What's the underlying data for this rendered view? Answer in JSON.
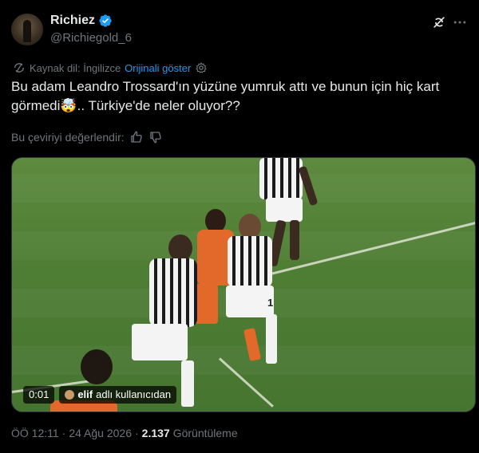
{
  "author": {
    "display_name": "Richiez",
    "handle": "@Richiegold_6"
  },
  "translation": {
    "source_label": "Kaynak dil: İngilizce",
    "show_original": "Orijinali göster"
  },
  "tweet": {
    "text_line1": "Bu adam Leandro Trossard'ın yüzüne yumruk attı ve bunun için hiç kart",
    "text_line2_start": "görmedi",
    "emoji": "🤯",
    "text_line2_end": ".. Türkiye'de neler oluyor??"
  },
  "rate": {
    "label": "Bu çeviriyi değerlendir:"
  },
  "media": {
    "timestamp": "0:01",
    "attribution_user": "elif",
    "attribution_suffix": "adlı kullanıcıdan",
    "player_number": "1"
  },
  "meta": {
    "time": "ÖÖ 12:11",
    "date": "24 Ağu 2026",
    "views": "2.137",
    "views_label": "Görüntüleme",
    "separator": "·"
  },
  "icons": {
    "verified_color": "#1d9bf0",
    "link_color": "#1d9bf0"
  }
}
